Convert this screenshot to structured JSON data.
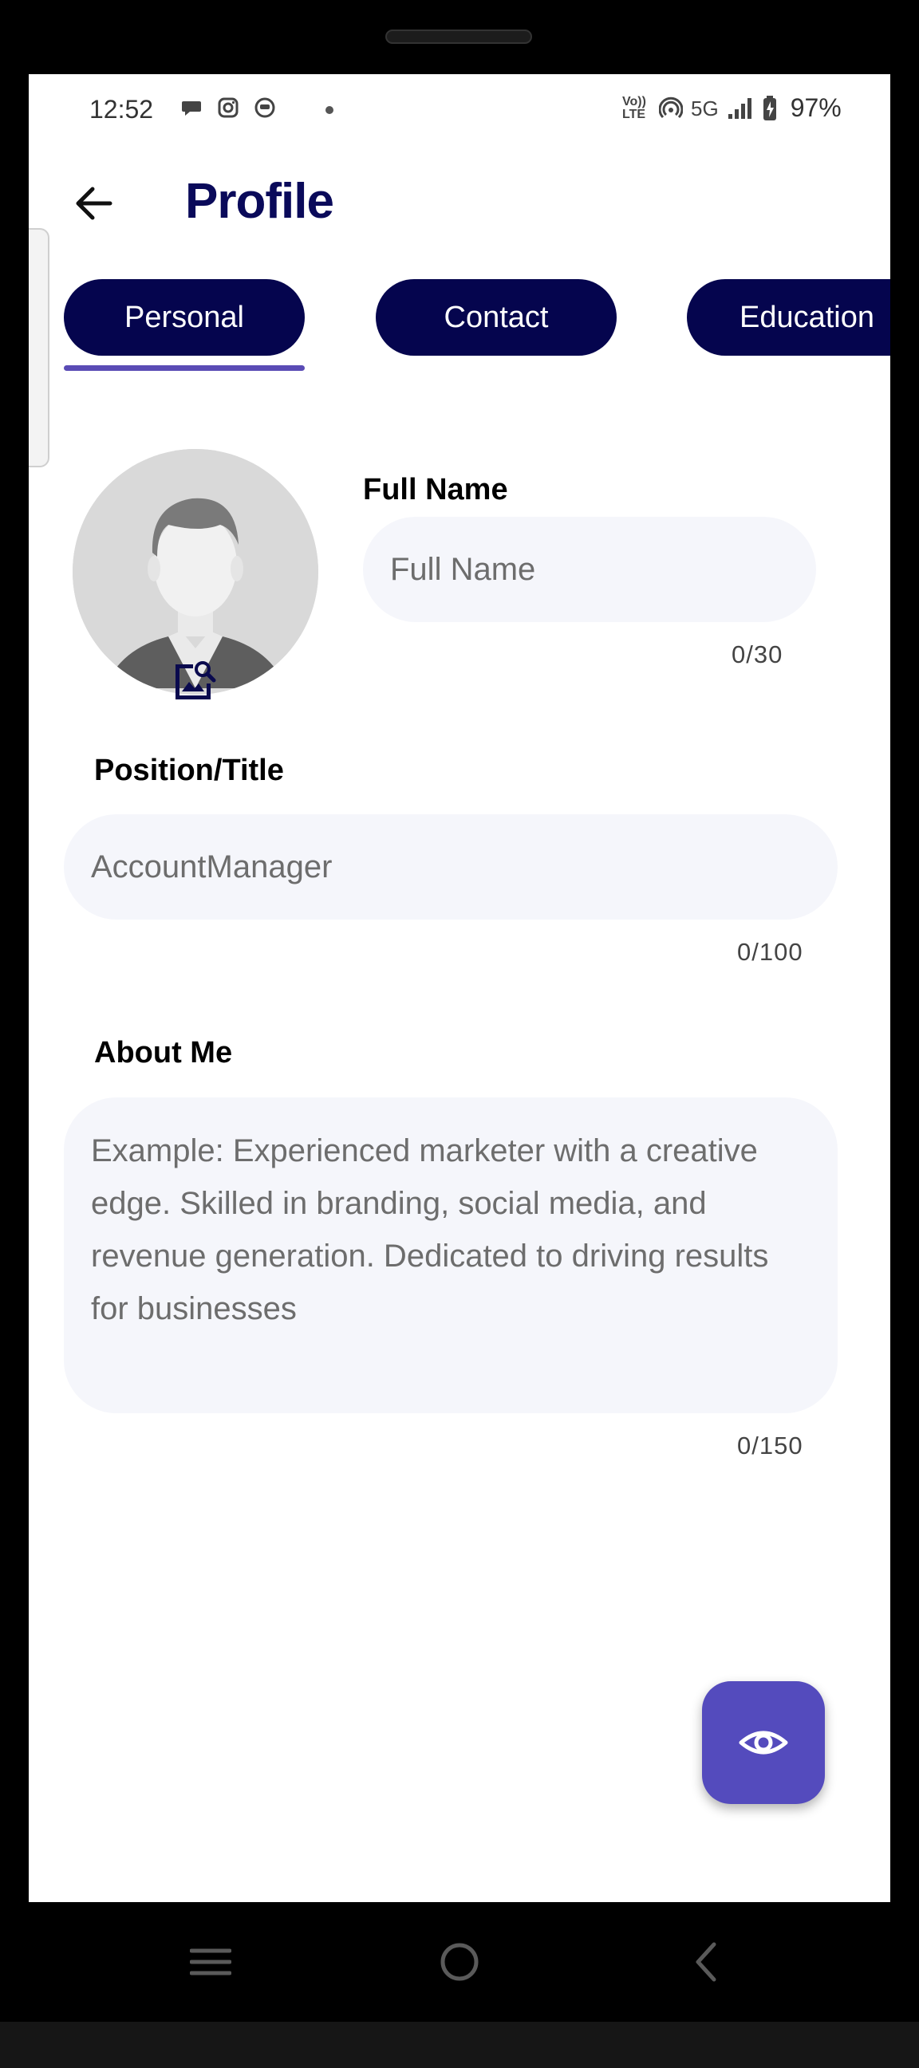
{
  "status_bar": {
    "time": "12:52",
    "network": "5G",
    "volte": "Vo)) LTE",
    "battery": "97%"
  },
  "header": {
    "title": "Profile",
    "back_icon": "arrow-left-icon"
  },
  "tabs": [
    {
      "label": "Personal",
      "active": true
    },
    {
      "label": "Contact",
      "active": false
    },
    {
      "label": "Education",
      "active": false
    }
  ],
  "form": {
    "full_name": {
      "label": "Full Name",
      "placeholder": "Full Name",
      "counter": "0/30"
    },
    "position": {
      "label": "Position/Title",
      "placeholder": "AccountManager",
      "counter": "0/100"
    },
    "about": {
      "label": "About Me",
      "placeholder": "Example: Experienced marketer with a creative edge. Skilled in branding, social media, and revenue generation. Dedicated to driving results for businesses",
      "counter": "0/150"
    }
  },
  "fab": {
    "icon": "eye-icon"
  },
  "colors": {
    "title": "#0a0a5a",
    "tab_bg": "#05054e",
    "tab_indicator": "#5a4bb5",
    "fab": "#544bbd",
    "field_bg": "#f5f6fb"
  }
}
